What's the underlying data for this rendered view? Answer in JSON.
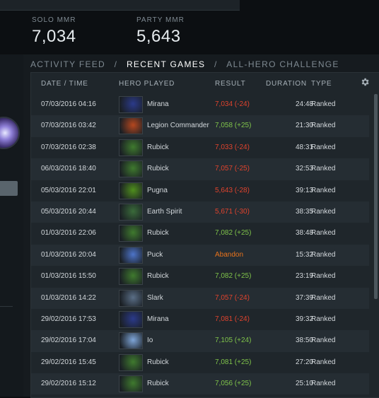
{
  "mmr": {
    "solo_label": "SOLO MMR",
    "solo_value": "7,034",
    "party_label": "PARTY MMR",
    "party_value": "5,643"
  },
  "tabs": [
    "ACTIVITY FEED",
    "RECENT GAMES",
    "ALL-HERO CHALLENGE"
  ],
  "active_tab": "RECENT GAMES",
  "columns": {
    "date": "DATE / TIME",
    "hero": "HERO PLAYED",
    "result": "RESULT",
    "duration": "DURATION",
    "type": "TYPE"
  },
  "games": [
    {
      "date": "07/03/2016  04:16",
      "hero": "Mirana",
      "result": "7,034 (-24)",
      "status": "loss",
      "duration": "24:48",
      "type": "Ranked",
      "portrait": "#2b3a8a"
    },
    {
      "date": "07/03/2016  03:42",
      "hero": "Legion Commander",
      "result": "7,058 (+25)",
      "status": "win",
      "duration": "21:30",
      "type": "Ranked",
      "portrait": "#b5471f"
    },
    {
      "date": "07/03/2016  02:38",
      "hero": "Rubick",
      "result": "7,033 (-24)",
      "status": "loss",
      "duration": "48:31",
      "type": "Ranked",
      "portrait": "#3f7a2e"
    },
    {
      "date": "06/03/2016  18:40",
      "hero": "Rubick",
      "result": "7,057 (-25)",
      "status": "loss",
      "duration": "32:53",
      "type": "Ranked",
      "portrait": "#3f7a2e"
    },
    {
      "date": "05/03/2016  22:01",
      "hero": "Pugna",
      "result": "5,643 (-28)",
      "status": "loss",
      "duration": "39:13",
      "type": "Ranked",
      "portrait": "#4f8e1d"
    },
    {
      "date": "05/03/2016  20:44",
      "hero": "Earth Spirit",
      "result": "5,671 (-30)",
      "status": "loss",
      "duration": "38:35",
      "type": "Ranked",
      "portrait": "#3a6b3a"
    },
    {
      "date": "01/03/2016  22:06",
      "hero": "Rubick",
      "result": "7,082 (+25)",
      "status": "win",
      "duration": "38:48",
      "type": "Ranked",
      "portrait": "#3f7a2e"
    },
    {
      "date": "01/03/2016  20:04",
      "hero": "Puck",
      "result": "Abandon",
      "status": "abandon",
      "duration": "15:32",
      "type": "Ranked",
      "portrait": "#4d74c9"
    },
    {
      "date": "01/03/2016  15:50",
      "hero": "Rubick",
      "result": "7,082 (+25)",
      "status": "win",
      "duration": "23:19",
      "type": "Ranked",
      "portrait": "#3f7a2e"
    },
    {
      "date": "01/03/2016  14:22",
      "hero": "Slark",
      "result": "7,057 (-24)",
      "status": "loss",
      "duration": "37:39",
      "type": "Ranked",
      "portrait": "#5a6e86"
    },
    {
      "date": "29/02/2016  17:53",
      "hero": "Mirana",
      "result": "7,081 (-24)",
      "status": "loss",
      "duration": "39:32",
      "type": "Ranked",
      "portrait": "#2b3a8a"
    },
    {
      "date": "29/02/2016  17:04",
      "hero": "Io",
      "result": "7,105 (+24)",
      "status": "win",
      "duration": "38:50",
      "type": "Ranked",
      "portrait": "#7ea5d8"
    },
    {
      "date": "29/02/2016  15:45",
      "hero": "Rubick",
      "result": "7,081 (+25)",
      "status": "win",
      "duration": "27:20",
      "type": "Ranked",
      "portrait": "#3f7a2e"
    },
    {
      "date": "29/02/2016  15:12",
      "hero": "Rubick",
      "result": "7,056 (+25)",
      "status": "win",
      "duration": "25:10",
      "type": "Ranked",
      "portrait": "#3f7a2e"
    }
  ],
  "colors": {
    "loss": "#e0432d",
    "win": "#7fc34a",
    "abandon": "#e8731c"
  },
  "icons": {
    "settings": "gear-icon"
  }
}
